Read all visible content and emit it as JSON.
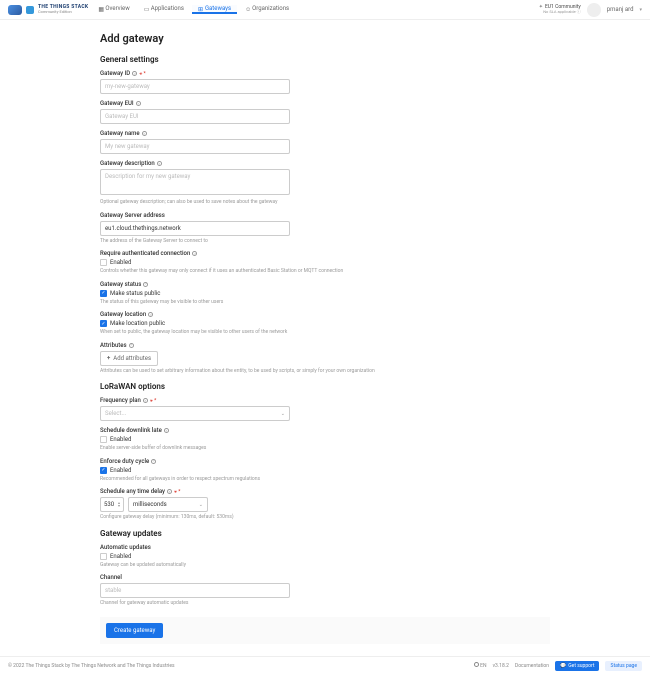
{
  "brand": {
    "main": "THE THINGS STACK",
    "sub": "Community Edition"
  },
  "nav": {
    "overview": "Overview",
    "applications": "Applications",
    "gateways": "Gateways",
    "organizations": "Organizations"
  },
  "cluster": {
    "name": "EU1 Community",
    "sub": "No SLA applicable"
  },
  "user": {
    "name": "pmanj ard"
  },
  "page_title": "Add gateway",
  "sections": {
    "general": "General settings",
    "lorawan": "LoRaWAN options",
    "updates": "Gateway updates"
  },
  "fields": {
    "gateway_id": {
      "label": "Gateway ID",
      "placeholder": "my-new-gateway"
    },
    "gateway_eui": {
      "label": "Gateway EUI",
      "placeholder": "Gateway EUI"
    },
    "gateway_name": {
      "label": "Gateway name",
      "placeholder": "My new gateway"
    },
    "gateway_desc": {
      "label": "Gateway description",
      "placeholder": "Description for my new gateway",
      "hint": "Optional gateway description; can also be used to save notes about the gateway"
    },
    "server_addr": {
      "label": "Gateway Server address",
      "value": "eu1.cloud.thethings.network",
      "hint": "The address of the Gateway Server to connect to"
    },
    "auth_conn": {
      "label": "Require authenticated connection",
      "check": "Enabled",
      "hint": "Controls whether this gateway may only connect if it uses an authenticated Basic Station or MQTT connection"
    },
    "status": {
      "label": "Gateway status",
      "check": "Make status public",
      "hint": "The status of this gateway may be visible to other users"
    },
    "location": {
      "label": "Gateway location",
      "check": "Make location public",
      "hint": "When set to public, the gateway location may be visible to other users of the network"
    },
    "attributes": {
      "label": "Attributes",
      "btn": "Add attributes",
      "hint": "Attributes can be used to set arbitrary information about the entity, to be used by scripts, or simply for your own organization"
    },
    "freq_plan": {
      "label": "Frequency plan",
      "placeholder": "Select..."
    },
    "sched_down": {
      "label": "Schedule downlink late",
      "check": "Enabled",
      "hint": "Enable server-side buffer of downlink messages"
    },
    "duty_cycle": {
      "label": "Enforce duty cycle",
      "check": "Enabled",
      "hint": "Recommended for all gateways in order to respect spectrum regulations"
    },
    "delay": {
      "label": "Schedule any time delay",
      "value": "530",
      "unit": "milliseconds",
      "hint": "Configure gateway delay (minimum: 130ms, default: 530ms)"
    },
    "auto_update": {
      "label": "Automatic updates",
      "check": "Enabled",
      "hint": "Gateway can be updated automatically"
    },
    "channel": {
      "label": "Channel",
      "placeholder": "stable",
      "hint": "Channel for gateway automatic updates"
    }
  },
  "submit": "Create gateway",
  "footer": {
    "copyright": "© 2022 The Things Stack by The Things Network and The Things Industries",
    "lang": "EN",
    "version": "v3.18.2",
    "docs": "Documentation",
    "support": "Get support",
    "status": "Status page"
  }
}
